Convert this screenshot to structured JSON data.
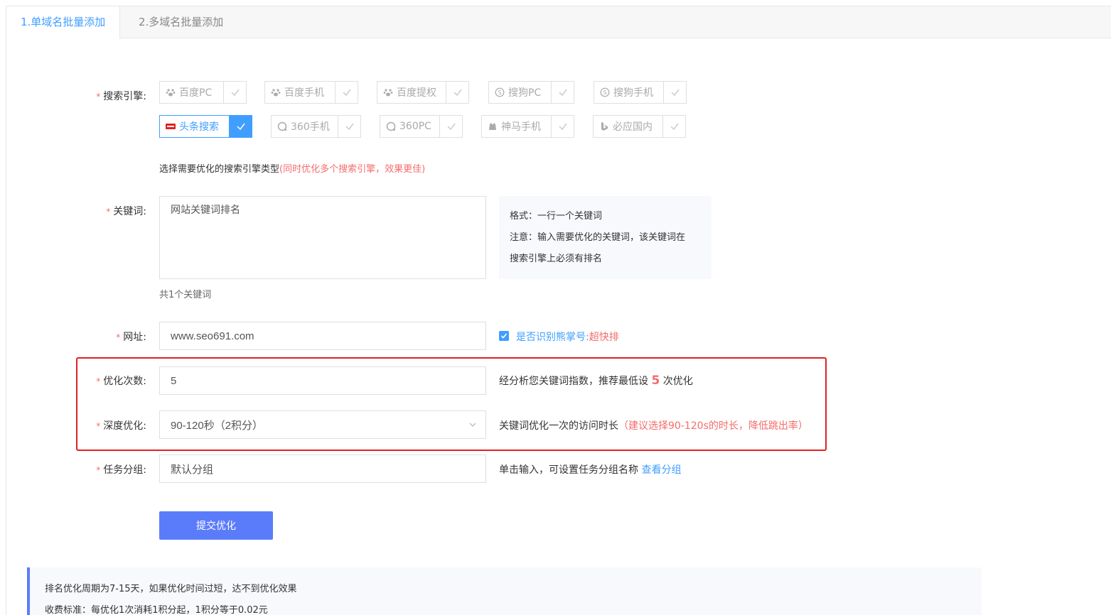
{
  "tabs": [
    {
      "label": "1.单域名批量添加"
    },
    {
      "label": "2.多域名批量添加"
    }
  ],
  "engines_section": {
    "label": "搜索引擎:",
    "row1": [
      {
        "name": "百度PC",
        "icon": "baidu-paw-icon",
        "selected": false
      },
      {
        "name": "百度手机",
        "icon": "baidu-paw-icon",
        "selected": false
      },
      {
        "name": "百度提权",
        "icon": "baidu-paw-icon",
        "selected": false
      },
      {
        "name": "搜狗PC",
        "icon": "sogou-icon",
        "selected": false
      },
      {
        "name": "搜狗手机",
        "icon": "sogou-icon",
        "selected": false
      }
    ],
    "row2": [
      {
        "name": "头条搜索",
        "icon": "toutiao-icon",
        "selected": true
      },
      {
        "name": "360手机",
        "icon": "360-icon",
        "selected": false
      },
      {
        "name": "360PC",
        "icon": "360-icon",
        "selected": false
      },
      {
        "name": "神马手机",
        "icon": "shenma-icon",
        "selected": false
      },
      {
        "name": "必应国内",
        "icon": "bing-icon",
        "selected": false
      }
    ],
    "hint": "选择需要优化的搜索引擎类型",
    "hint_red": "(同时优化多个搜索引擎，效果更佳)"
  },
  "keywords": {
    "label": "关键词:",
    "value": "网站关键词排名",
    "count": "共1个关键词",
    "tip_line1": "格式：一行一个关键词",
    "tip_line2": "注意：输入需要优化的关键词，该关键词在",
    "tip_line3": "搜索引擎上必须有排名"
  },
  "url": {
    "label": "网址:",
    "value": "www.seo691.com",
    "checkbox_label": "是否识别熊掌号:",
    "checkbox_red": "超快排",
    "checked": true
  },
  "times": {
    "label": "优化次数:",
    "value": "5",
    "hint_pre": "经分析您关键词指数，推荐最低设",
    "hint_num": "5",
    "hint_post": "次优化"
  },
  "depth": {
    "label": "深度优化:",
    "value": "90-120秒（2积分）",
    "hint": "关键词优化一次的访问时长",
    "hint_red": "（建议选择90-120s的时长，降低跳出率）"
  },
  "group": {
    "label": "任务分组:",
    "value": "默认分组",
    "hint": "单击输入，可设置任务分组名称",
    "link": "查看分组"
  },
  "submit_label": "提交优化",
  "notice": {
    "line1": "排名优化周期为7-15天，如果优化时间过短，达不到优化效果",
    "line2": "收费标准：每优化1次消耗1积分起，1积分等于0.02元"
  },
  "colors": {
    "accent": "#409eff",
    "button": "#5b7cfa",
    "warning_red": "#f56c6c",
    "highlight_border": "#e02020"
  }
}
